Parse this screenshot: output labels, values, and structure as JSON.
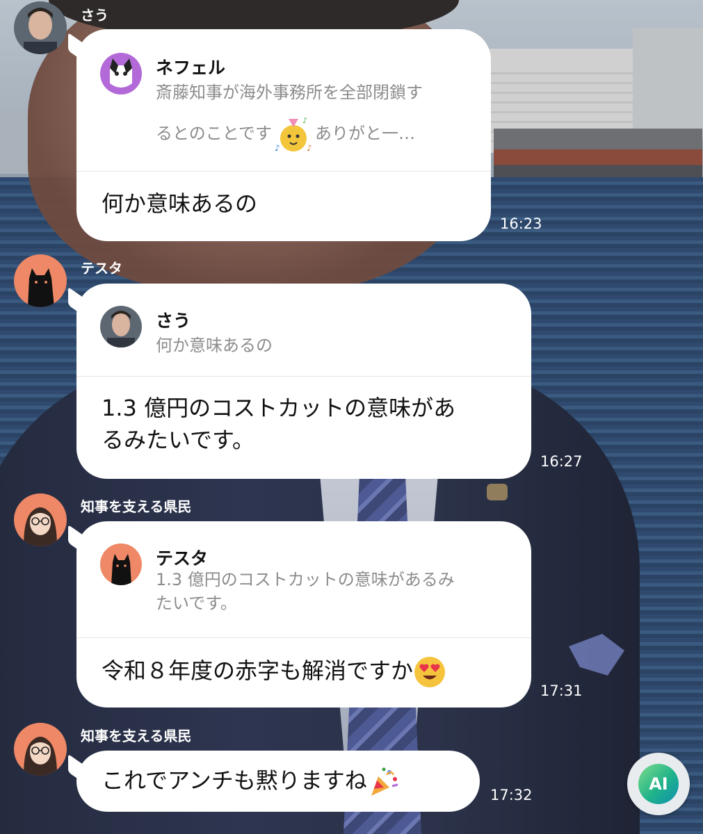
{
  "messages": [
    {
      "sender": "さう",
      "reply_to": {
        "name": "ネフェル",
        "text_line1": "斎藤知事が海外事務所を全部閉鎖す",
        "text_line2a": "るとのことです",
        "text_line2b": "ありがと一…",
        "sticker": "party-sticker"
      },
      "text": "何か意味あるの",
      "time": "16:23"
    },
    {
      "sender": "テスタ",
      "reply_to": {
        "name": "さう",
        "text_line1": "何か意味あるの"
      },
      "text_line1": "1.3 億円のコストカットの意味があ",
      "text_line2": "るみたいです。",
      "time": "16:27"
    },
    {
      "sender": "知事を支える県民",
      "reply_to": {
        "name": "テスタ",
        "text_line1": "1.3 億円のコストカットの意味があるみ",
        "text_line2": "たいです。"
      },
      "text": "令和８年度の赤字も解消ですか",
      "emoji": "heart-eyes-emoji",
      "time": "17:31"
    },
    {
      "sender": "知事を支える県民",
      "text": "これでアンチも黙りますね",
      "emoji": "party-popper-emoji",
      "time": "17:32"
    }
  ],
  "ai_button": {
    "label": "AI"
  }
}
